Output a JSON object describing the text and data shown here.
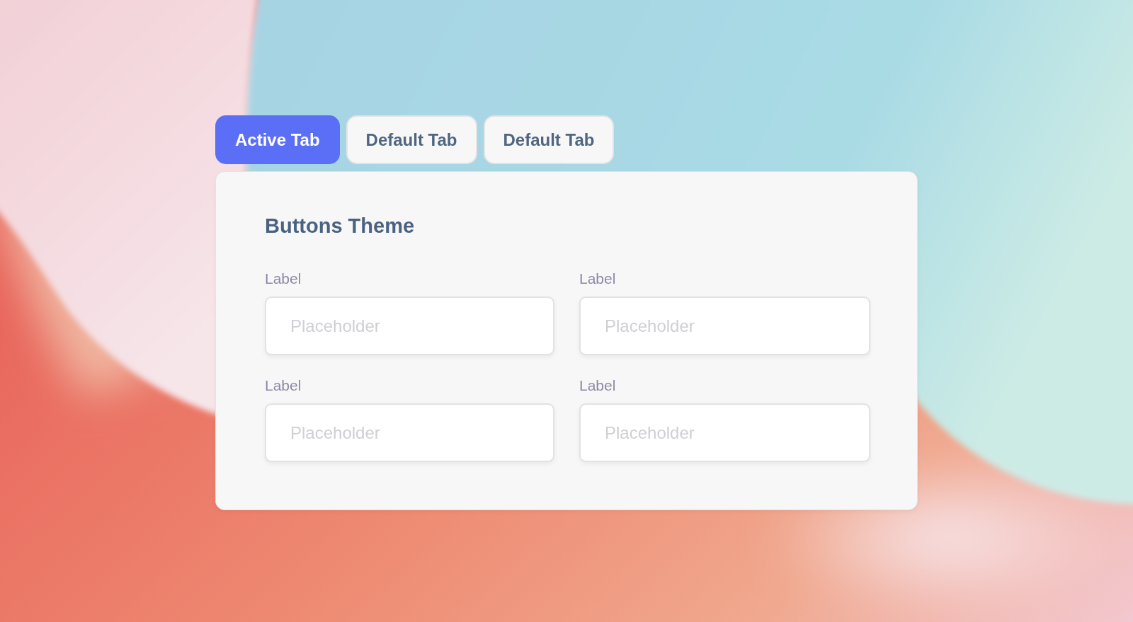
{
  "tabs": [
    {
      "label": "Active Tab",
      "selected": true
    },
    {
      "label": "Default Tab",
      "selected": false
    },
    {
      "label": "Default Tab",
      "selected": false
    }
  ],
  "panel": {
    "title": "Buttons Theme",
    "fields": [
      {
        "label": "Label",
        "placeholder": "Placeholder"
      },
      {
        "label": "Label",
        "placeholder": "Placeholder"
      },
      {
        "label": "Label",
        "placeholder": "Placeholder"
      },
      {
        "label": "Label",
        "placeholder": "Placeholder"
      }
    ]
  }
}
